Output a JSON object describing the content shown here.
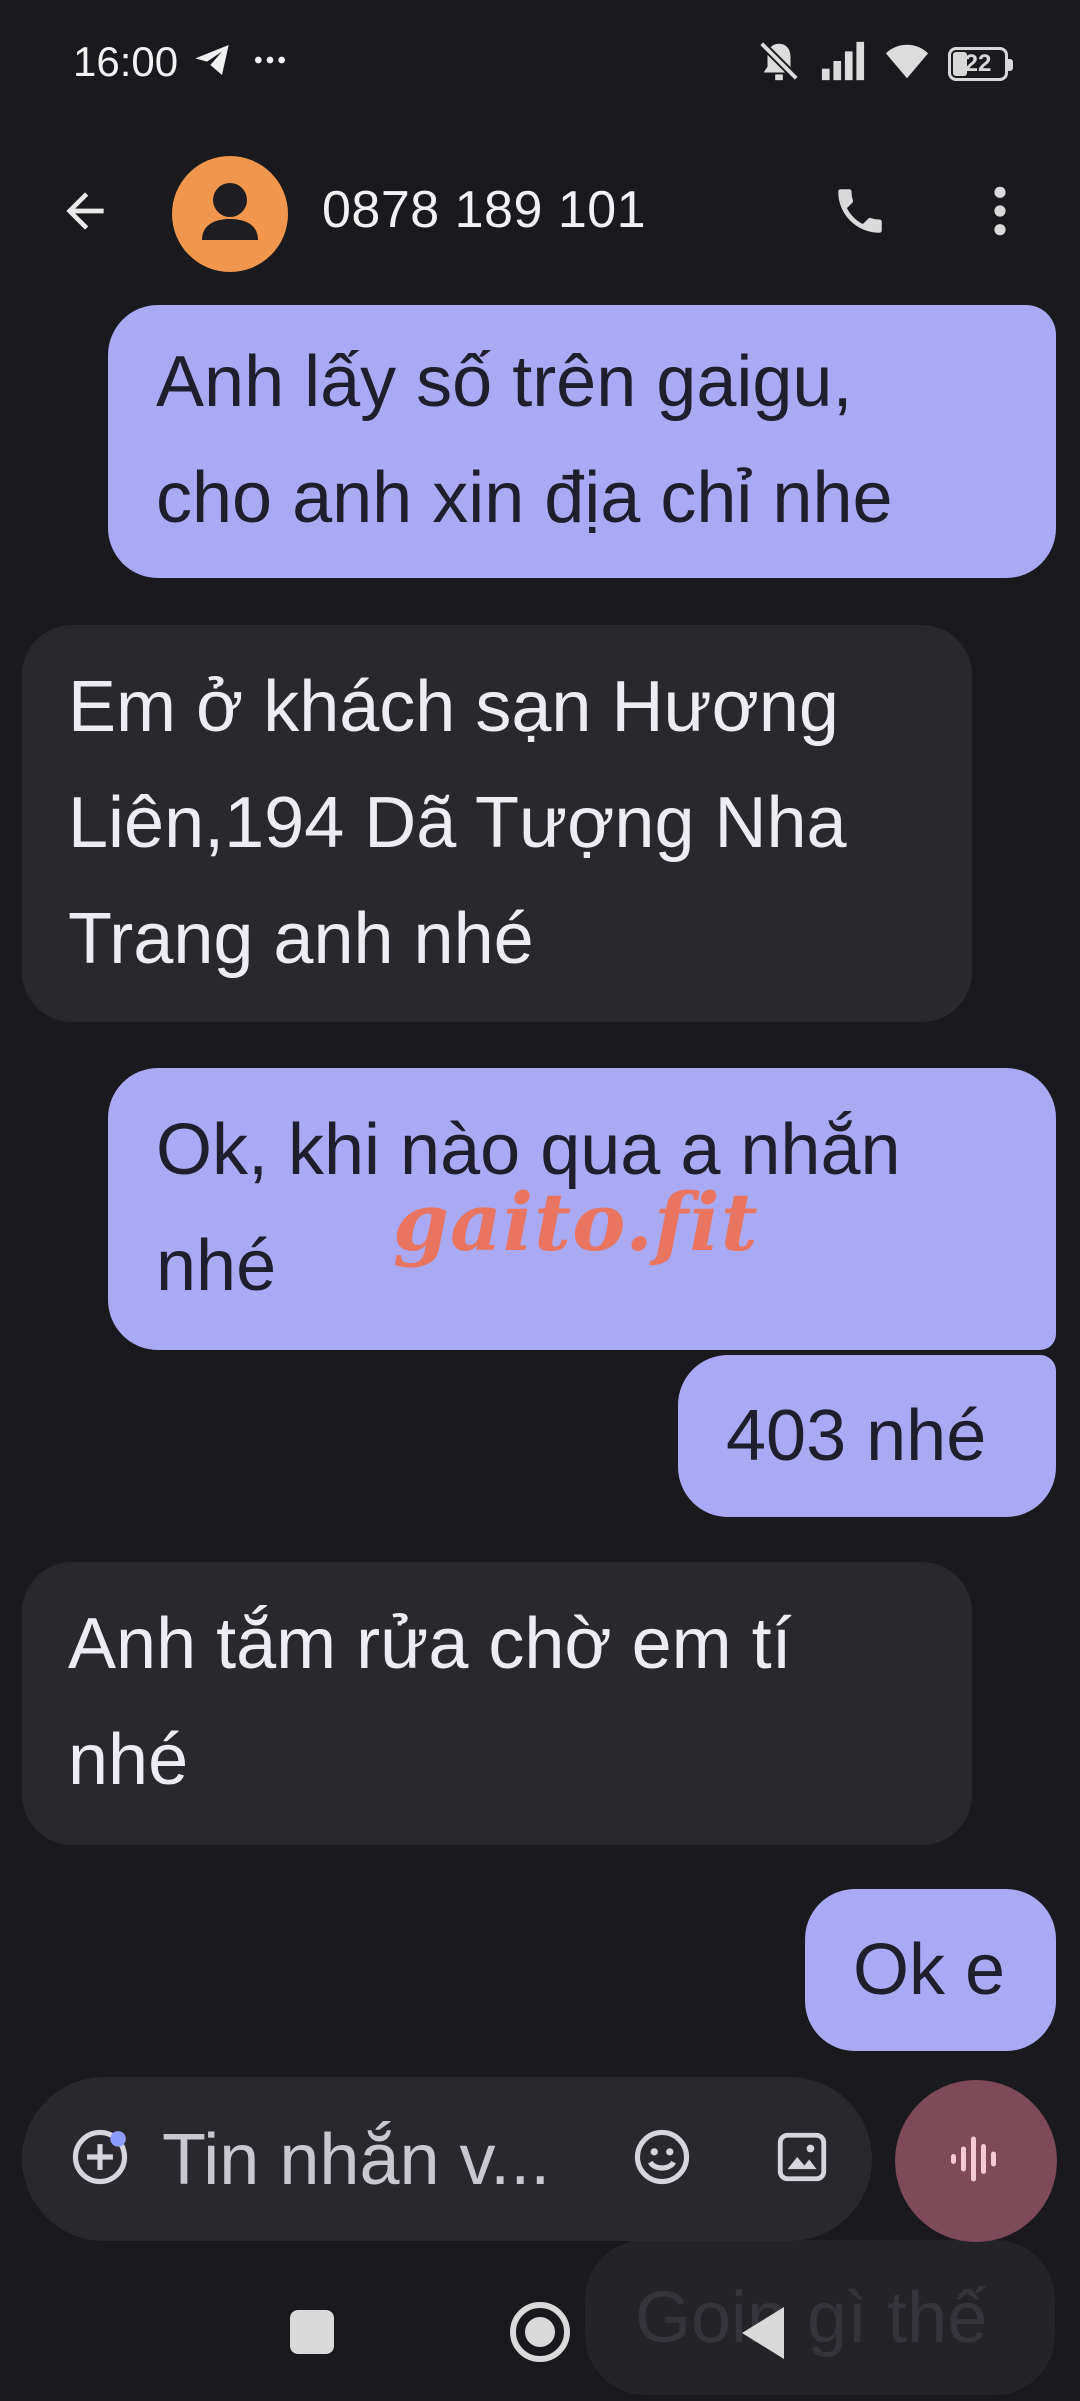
{
  "status_bar": {
    "time": "16:00",
    "left_icons": [
      "telegram-icon",
      "more-notifications-icon"
    ],
    "right_icons": [
      "mute-icon",
      "signal-icon",
      "wifi-icon",
      "battery-icon"
    ],
    "battery_level": "22"
  },
  "app_bar": {
    "back_icon": "arrow-back-icon",
    "contact_name": "0878 189 101",
    "call_icon": "phone-icon",
    "menu_icon": "more-vert-icon"
  },
  "messages": [
    {
      "direction": "outgoing",
      "lines": [
        "Anh lấy số trên gaigu,",
        "cho anh xin địa chỉ nhe"
      ]
    },
    {
      "direction": "incoming",
      "lines": [
        "Em ở khách sạn Hương",
        "Liên,194 Dã Tượng Nha",
        "Trang anh nhé"
      ]
    },
    {
      "direction": "outgoing",
      "lines": [
        "Ok, khi nào qua a nhắn",
        "nhé"
      ]
    },
    {
      "direction": "outgoing",
      "lines": [
        "403 nhé"
      ]
    },
    {
      "direction": "incoming",
      "lines": [
        "Anh tắm rửa chờ em tí",
        "nhé"
      ]
    },
    {
      "direction": "outgoing",
      "lines": [
        "Ok e"
      ]
    }
  ],
  "watermark": "gaito.fit",
  "compose": {
    "placeholder": "Tin nhắn v...",
    "add_icon": "add-circle-icon",
    "emoji_icon": "emoji-icon",
    "media_icon": "image-icon",
    "voice_icon": "voice-wave-icon"
  },
  "ghost_suggestion": "Goin gì thế",
  "nav_bar": {
    "recent_icon": "recent-apps-icon",
    "home_icon": "home-icon",
    "back_icon": "nav-back-icon"
  },
  "colors": {
    "background": "#1a1a1e",
    "outgoing_bubble": "#aaaaf4",
    "incoming_bubble": "#28282d",
    "avatar": "#f0974d",
    "voice_button": "#7e4958",
    "watermark": "#e9745f"
  }
}
